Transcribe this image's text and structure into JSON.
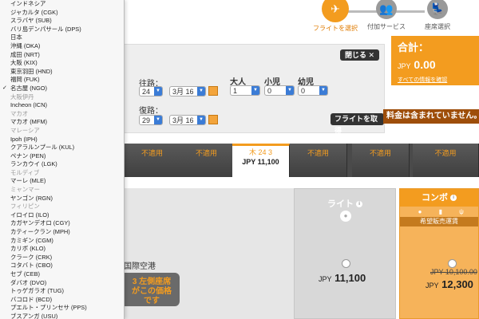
{
  "steps": [
    {
      "label": "フライトを選択",
      "icon": "plane-icon",
      "active": true
    },
    {
      "label": "付加サービス",
      "icon": "people-icon",
      "active": false
    },
    {
      "label": "座席選択",
      "icon": "seat-icon",
      "active": false
    }
  ],
  "search": {
    "close_label": "閉じる ✕",
    "outbound_label": "往路：",
    "return_label": "復路：",
    "outbound_day": "24",
    "outbound_month": "3月 16",
    "return_day": "29",
    "return_month": "3月 16",
    "adult_label": "大人",
    "child_label": "小児",
    "infant_label": "幼児",
    "adult_value": "1",
    "child_value": "0",
    "infant_value": "0",
    "search_button": "フライトを取得"
  },
  "total": {
    "label": "合計：",
    "currency": "JPY",
    "amount": "0.00",
    "details_link": "すべての情報を確認"
  },
  "notice": "料金は含まれていません。",
  "carousel": [
    {
      "label": "不適用"
    },
    {
      "label": "不適用"
    },
    {
      "label": "木 24 3",
      "price": "JPY 11,100",
      "selected": true
    },
    {
      "label": "不適用"
    },
    {
      "label": "不適用"
    },
    {
      "label": "不適用"
    }
  ],
  "route": {
    "text": "国際空港",
    "seat_badge_line1": "3 左側座席",
    "seat_badge_line2": "がこの価格",
    "seat_badge_line3": "です"
  },
  "fares": {
    "light": {
      "name": "ライト",
      "currency": "JPY",
      "price": "11,100"
    },
    "combo": {
      "name": "コンボ",
      "band": "希望販売運賃",
      "currency": "JPY",
      "old_price": "JPY 10,100.00",
      "price": "12,300"
    }
  },
  "dropdown": {
    "selected_index": 14,
    "items": [
      {
        "label": "インドネシア",
        "muted": false
      },
      {
        "label": "ジャカルタ (CGK)",
        "muted": false
      },
      {
        "label": "スラバヤ (SUB)",
        "muted": false
      },
      {
        "label": "バリ島デンパサール (DPS)",
        "muted": false
      },
      {
        "label": "日本",
        "muted": false
      },
      {
        "label": "沖縄 (OKA)",
        "muted": false
      },
      {
        "label": "成田 (NRT)",
        "muted": false
      },
      {
        "label": "大阪 (KIX)",
        "muted": false
      },
      {
        "label": "東京羽田 (HND)",
        "muted": false
      },
      {
        "label": "福岡 (FUK)",
        "muted": false
      },
      {
        "label": "名古屋 (NGO)",
        "muted": false
      },
      {
        "label": "大阪伊丹",
        "muted": true
      },
      {
        "label": "Incheon (ICN)",
        "muted": false
      },
      {
        "label": "マカオ",
        "muted": true
      },
      {
        "label": "マカオ (MFM)",
        "muted": false
      },
      {
        "label": "マレーシア",
        "muted": true
      },
      {
        "label": "Ipoh (IPH)",
        "muted": false
      },
      {
        "label": "クアラルンプール (KUL)",
        "muted": false
      },
      {
        "label": "ペナン (PEN)",
        "muted": false
      },
      {
        "label": "ランカウイ (LGK)",
        "muted": false
      },
      {
        "label": "モルディブ",
        "muted": true
      },
      {
        "label": "マーレ (MLE)",
        "muted": false
      },
      {
        "label": "ミャンマー",
        "muted": true
      },
      {
        "label": "ヤンゴン (RGN)",
        "muted": false
      },
      {
        "label": "フィリピン",
        "muted": true
      },
      {
        "label": "イロイロ (ILO)",
        "muted": false
      },
      {
        "label": "カガヤンデオロ (CGY)",
        "muted": false
      },
      {
        "label": "カティークラン (MPH)",
        "muted": false
      },
      {
        "label": "カミギン (CGM)",
        "muted": false
      },
      {
        "label": "カリボ (KLO)",
        "muted": false
      },
      {
        "label": "クラーク (CRK)",
        "muted": false
      },
      {
        "label": "コタバト (CBO)",
        "muted": false
      },
      {
        "label": "セブ (CEB)",
        "muted": false
      },
      {
        "label": "ダバオ (DVO)",
        "muted": false
      },
      {
        "label": "トゥゲガラオ (TUG)",
        "muted": false
      },
      {
        "label": "バコロド (BCD)",
        "muted": false
      },
      {
        "label": "プエルト・プリンセサ (PPS)",
        "muted": false
      },
      {
        "label": "ブスアンガ (USU)",
        "muted": false
      }
    ]
  },
  "colors": {
    "accent": "#f39c1f",
    "dark": "#4a4a4a",
    "select_blue": "#3b7cd6"
  }
}
